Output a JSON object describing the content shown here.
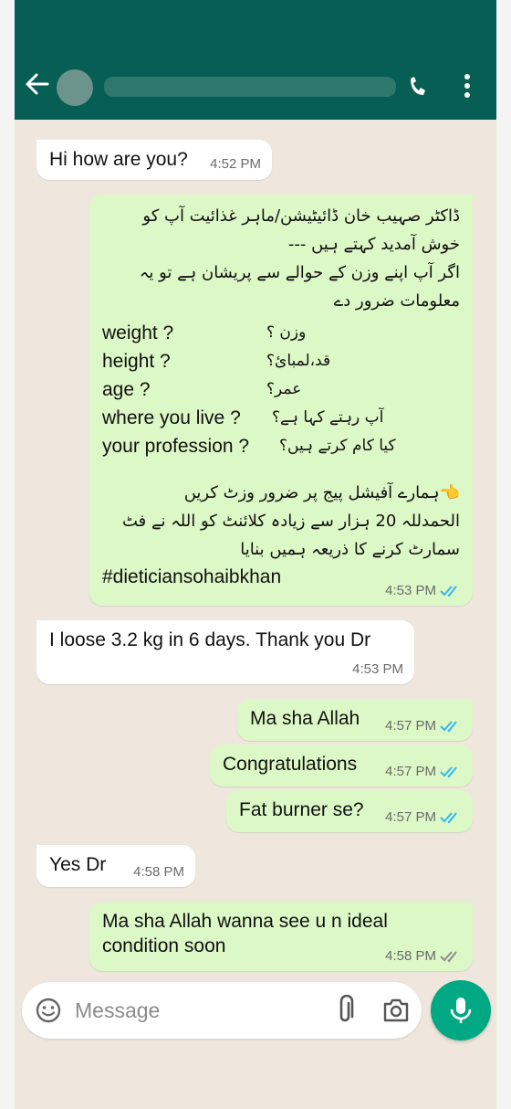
{
  "header": {
    "back_icon": "arrow-left-icon",
    "call_icon": "phone-icon",
    "menu_icon": "more-vertical-icon"
  },
  "messages": [
    {
      "direction": "incoming",
      "text": "Hi how are you?",
      "time": "4:52 PM"
    },
    {
      "direction": "outgoing",
      "urdu_intro": [
        "ڈاکٹر صہیب خان ڈائیٹیشن/ماہر غذائیت آپ کو",
        "خوش آمدید کہتے ہیں ---",
        "اگر آپ اپنے وزن کے حوالے سے پریشان ہے تو یہ",
        "معلومات ضرور دے"
      ],
      "questions": [
        {
          "en": "weight ?",
          "ur": "وزن ؟"
        },
        {
          "en": "height ?",
          "ur": "قد،لمبائ؟"
        },
        {
          "en": "age  ?",
          "ur": "عمر؟"
        },
        {
          "en": "where you live ?",
          "ur": "آپ رہتے کہا ہے؟"
        },
        {
          "en": "your profession ?",
          "ur": "کیا کام کرتے ہیں؟"
        }
      ],
      "urdu_outro": [
        "👈ہمارے آفیشل پیج پر ضرور وزٹ کریں",
        "الحمدللہ 20 ہزار سے زیادہ کلائنٹ کو اللہ نے فٹ",
        "سمارٹ کرنے کا ذریعہ ہمیں بنایا"
      ],
      "hashtag": "#dieticiansohaibkhan",
      "time": "4:53 PM",
      "status": "read"
    },
    {
      "direction": "incoming",
      "text": "I loose 3.2 kg in 6 days. Thank you Dr",
      "time": "4:53 PM"
    },
    {
      "direction": "outgoing",
      "text": "Ma sha Allah",
      "time": "4:57 PM",
      "status": "read"
    },
    {
      "direction": "outgoing",
      "text": "Congratulations",
      "time": "4:57 PM",
      "status": "read"
    },
    {
      "direction": "outgoing",
      "text": "Fat burner se?",
      "time": "4:57 PM",
      "status": "read"
    },
    {
      "direction": "incoming",
      "text": "Yes Dr",
      "time": "4:58 PM"
    },
    {
      "direction": "outgoing",
      "text": "Ma sha Allah wanna see u n ideal condition soon",
      "time": "4:58 PM",
      "status": "delivered"
    }
  ],
  "composer": {
    "placeholder": "Message",
    "emoji_icon": "emoji-icon",
    "attach_icon": "paperclip-icon",
    "camera_icon": "camera-icon",
    "mic_icon": "microphone-icon"
  },
  "colors": {
    "header": "#075e54",
    "chat_background": "#efe7dd",
    "incoming_bubble": "#ffffff",
    "outgoing_bubble": "#dcf8c6",
    "read_tick": "#34b7f1",
    "delivered_tick": "#8c8c8c",
    "mic_button": "#00a884"
  }
}
